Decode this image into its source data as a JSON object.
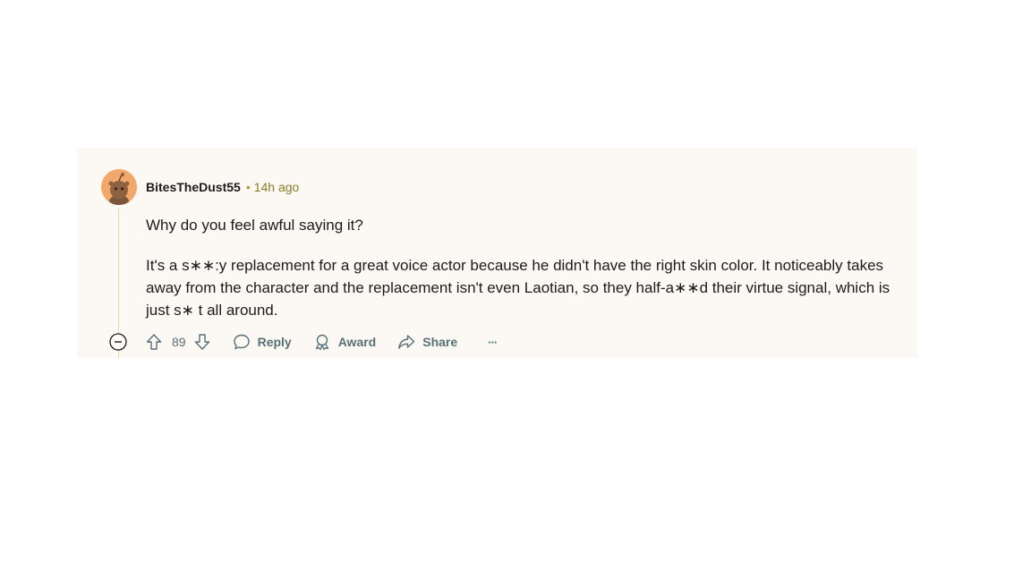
{
  "comment": {
    "username": "BitesTheDust55",
    "separator": "•",
    "timestamp": "14h ago",
    "paragraphs": [
      "Why do you feel awful saying it?",
      "It's a s∗∗:y replacement for a great voice actor because he didn't have the right skin color. It noticeably takes away from the character and the replacement isn't even Laotian, so they half-a∗∗d their virtue signal, which is just s∗ t all around."
    ],
    "score": "89",
    "actions": {
      "reply": "Reply",
      "award": "Award",
      "share": "Share",
      "more": "···"
    }
  },
  "colors": {
    "card_background": "#fcf9f4",
    "avatar_background": "#f2a86a",
    "thread_line": "#e4d8a4",
    "meta_text": "#8a7a2a",
    "action_text": "#576f76"
  },
  "icons": {
    "avatar": "reddit-snoo-avatar-icon",
    "collapse": "minus-circle-icon",
    "upvote": "arrow-up-icon",
    "downvote": "arrow-down-icon",
    "reply": "speech-bubble-icon",
    "award": "ribbon-award-icon",
    "share": "share-arrow-icon",
    "more": "ellipsis-icon"
  }
}
